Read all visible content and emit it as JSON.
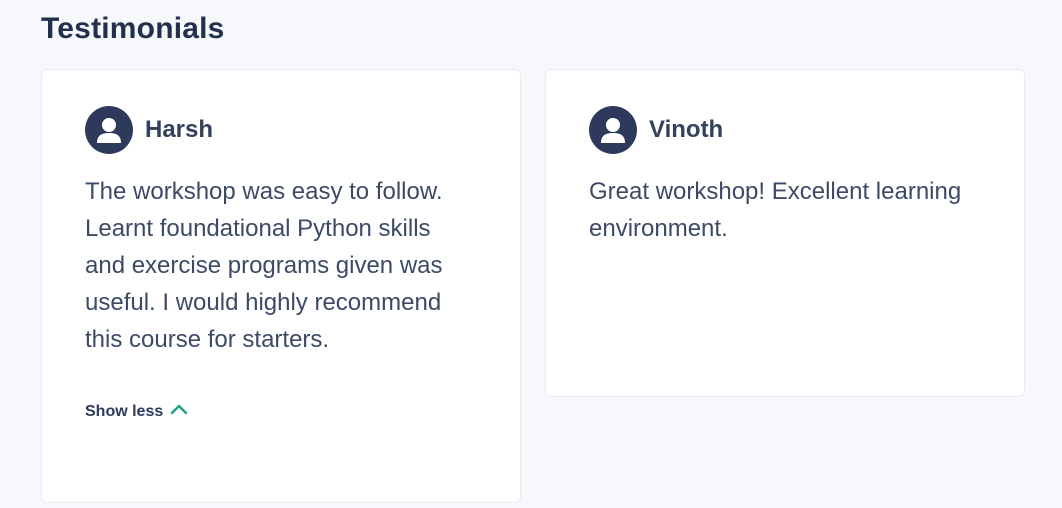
{
  "section": {
    "title": "Testimonials"
  },
  "testimonials": [
    {
      "name": "Harsh",
      "text": "The workshop was easy to follow. Learnt foundational Python skills and exercise programs given was useful. I would highly recommend this course for starters.",
      "toggle_label": "Show less"
    },
    {
      "name": "Vinoth",
      "text": "Great workshop! Excellent learning environment."
    }
  ],
  "icons": {
    "avatar": "user-icon",
    "toggle": "chevron-up-icon"
  },
  "colors": {
    "avatar_bg": "#2e3a5c",
    "accent": "#17a58a",
    "heading": "#23304d"
  }
}
